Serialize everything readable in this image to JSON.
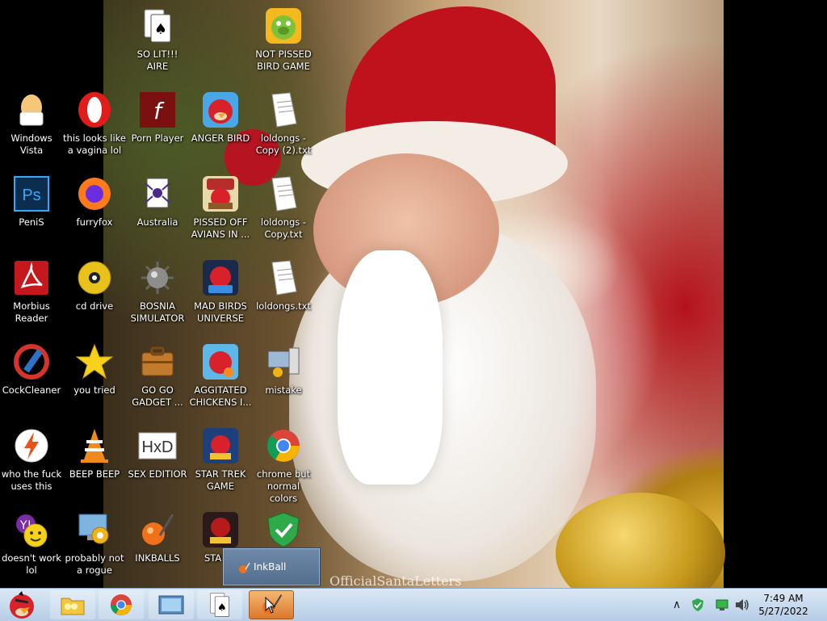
{
  "desktop": {
    "icons": [
      {
        "id": "so-lit-aire",
        "label": "SO LIT!!! AIRE",
        "icon": "solitaire-cards-icon"
      },
      {
        "id": "not-pissed-bird",
        "label": "NOT PISSED BIRD GAME",
        "icon": "green-pig-icon"
      },
      {
        "id": "windows-vista",
        "label": "Windows Vista",
        "icon": "egg-icon"
      },
      {
        "id": "opera",
        "label": "this looks like a vagina lol",
        "icon": "opera-icon"
      },
      {
        "id": "porn-player",
        "label": "Porn Player",
        "icon": "flash-player-icon"
      },
      {
        "id": "anger-bird",
        "label": "ANGER BIRD",
        "icon": "red-bird-icon"
      },
      {
        "id": "loldongs-copy2",
        "label": "loldongs - Copy (2).txt",
        "icon": "text-file-icon"
      },
      {
        "id": "penis",
        "label": "PeniS",
        "icon": "photoshop-icon"
      },
      {
        "id": "furryfox",
        "label": "furryfox",
        "icon": "firefox-icon"
      },
      {
        "id": "australia",
        "label": "Australia",
        "icon": "spider-solitaire-icon"
      },
      {
        "id": "pissed-off-avians",
        "label": "PISSED OFF AVIANS IN ...",
        "icon": "angry-birds-seasons-icon"
      },
      {
        "id": "loldongs-copy",
        "label": "loldongs - Copy.txt",
        "icon": "text-file-icon"
      },
      {
        "id": "morbius-reader",
        "label": "Morbius Reader",
        "icon": "adobe-reader-icon"
      },
      {
        "id": "cd-drive",
        "label": "cd drive",
        "icon": "cd-disc-icon"
      },
      {
        "id": "bosnia-simulator",
        "label": "BOSNIA SIMULATOR",
        "icon": "minesweeper-mine-icon"
      },
      {
        "id": "mad-birds-universe",
        "label": "MAD BIRDS UNIVERSE",
        "icon": "angry-birds-space-icon"
      },
      {
        "id": "loldongs",
        "label": "loldongs.txt",
        "icon": "text-file-icon"
      },
      {
        "id": "cockcleaner",
        "label": "CockCleaner",
        "icon": "ccleaner-icon"
      },
      {
        "id": "you-tried",
        "label": "you tried",
        "icon": "gold-star-icon"
      },
      {
        "id": "go-go-gadget",
        "label": "GO GO GADGET ...",
        "icon": "briefcase-icon"
      },
      {
        "id": "agitated-chickens",
        "label": "AGGITATED CHICKENS I...",
        "icon": "angry-birds-rio-icon"
      },
      {
        "id": "mistake",
        "label": "mistake",
        "icon": "computer-setup-icon"
      },
      {
        "id": "who-the-fuck",
        "label": "who the fuck uses this",
        "icon": "winamp-bolt-icon"
      },
      {
        "id": "beep-beep",
        "label": "BEEP BEEP",
        "icon": "vlc-cone-icon"
      },
      {
        "id": "sex-editior",
        "label": "SEX EDITIOR",
        "icon": "hxd-editor-icon"
      },
      {
        "id": "star-trek-game",
        "label": "STAR TREK GAME",
        "icon": "angry-birds-star-wars-icon"
      },
      {
        "id": "chrome-normal",
        "label": "chrome but normal colors",
        "icon": "chrome-icon"
      },
      {
        "id": "doesnt-work",
        "label": "doesn't work lol",
        "icon": "yahoo-messenger-icon"
      },
      {
        "id": "probably-rogue",
        "label": "probably not a rogue",
        "icon": "control-panel-gears-icon"
      },
      {
        "id": "inkballs",
        "label": "INKBALLS",
        "icon": "inkball-icon"
      },
      {
        "id": "star-t",
        "label": "STAR T",
        "icon": "angry-birds-star-wars-2-icon"
      },
      {
        "id": "security",
        "label": "",
        "icon": "security-shield-check-icon"
      }
    ]
  },
  "wallpaper": {
    "watermark": "OfficialSantaLetters"
  },
  "thumbnail": {
    "label": "InkBall",
    "icon": "inkball-icon"
  },
  "taskbar": {
    "start_icon": "angry-bird-start-icon",
    "buttons": [
      {
        "name": "explorer",
        "icon": "folder-icon"
      },
      {
        "name": "chrome",
        "icon": "chrome-icon"
      },
      {
        "name": "media",
        "icon": "media-center-icon"
      },
      {
        "name": "solitaire",
        "icon": "solitaire-cards-icon"
      },
      {
        "name": "inkball",
        "icon": "inkball-icon"
      }
    ],
    "tray_icons": [
      "show-hidden-icons-chevron",
      "security-shield-icon",
      "network-icon",
      "volume-icon"
    ],
    "clock_time": "7:49 AM",
    "clock_date": "5/27/2022"
  },
  "colors": {
    "accent": "#d9782a",
    "taskbar": "#c8daee"
  }
}
